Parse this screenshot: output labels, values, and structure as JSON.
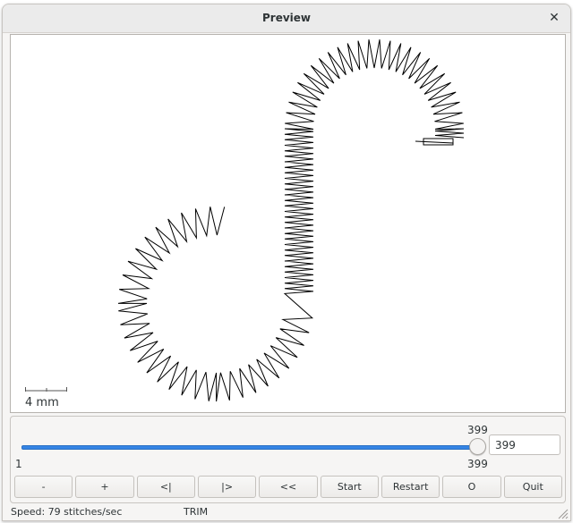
{
  "window": {
    "title": "Preview",
    "close_icon": "✕"
  },
  "canvas": {
    "scale_label": "4 mm",
    "stitch_color": "#000000"
  },
  "slider": {
    "min_label": "1",
    "max_label": "399",
    "current_label": "399",
    "value": 399,
    "min": 1,
    "max": 399,
    "accent": "#3584e4"
  },
  "spin": {
    "value": "399"
  },
  "buttons": {
    "minus": "-",
    "plus": "+",
    "step_back": "<|",
    "step_forward": "|>",
    "rewind": "<<",
    "start": "Start",
    "restart": "Restart",
    "o": "O",
    "quit": "Quit"
  },
  "status": {
    "speed": "Speed: 79 stitches/sec",
    "command": "TRIM"
  }
}
